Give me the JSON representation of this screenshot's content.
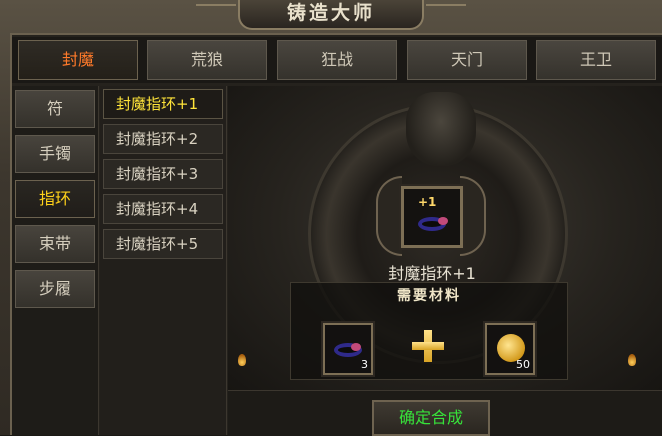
{
  "window": {
    "title": "铸造大师"
  },
  "top_tabs": [
    {
      "label": "封魔",
      "active": true
    },
    {
      "label": "荒狼",
      "active": false
    },
    {
      "label": "狂战",
      "active": false
    },
    {
      "label": "天门",
      "active": false
    },
    {
      "label": "王卫",
      "active": false
    }
  ],
  "categories": [
    {
      "label": "符",
      "active": false
    },
    {
      "label": "手镯",
      "active": false
    },
    {
      "label": "指环",
      "active": true
    },
    {
      "label": "束带",
      "active": false
    },
    {
      "label": "步履",
      "active": false
    }
  ],
  "sub_items": [
    {
      "label": "封魔指环+1",
      "active": true
    },
    {
      "label": "封魔指环+2",
      "active": false
    },
    {
      "label": "封魔指环+3",
      "active": false
    },
    {
      "label": "封魔指环+4",
      "active": false
    },
    {
      "label": "封魔指环+5",
      "active": false
    }
  ],
  "result": {
    "name": "封魔指环+1",
    "badge": "+1",
    "icon": "ring-icon"
  },
  "materials": {
    "title": "需要材料",
    "items": [
      {
        "icon": "ring-icon",
        "count": "3"
      },
      {
        "icon": "gold-coin-icon",
        "count": "50"
      }
    ]
  },
  "confirm_button": {
    "label": "确定合成"
  },
  "colors": {
    "active_tab": "#ff7a2a",
    "active_item": "#ffe43a",
    "confirm_text": "#37e23a"
  }
}
